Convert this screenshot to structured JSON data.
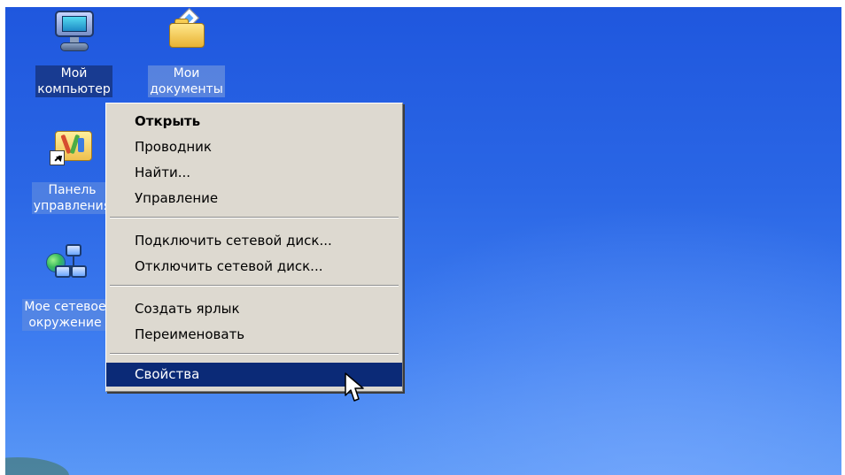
{
  "desktop": {
    "icons": [
      {
        "name": "my-computer",
        "icon": "computer-icon",
        "label_lines": [
          "Мой",
          "компьютер"
        ]
      },
      {
        "name": "my-documents",
        "icon": "documents-folder-icon",
        "label_lines": [
          "Мои",
          "документы"
        ]
      },
      {
        "name": "control-panel",
        "icon": "control-panel-icon",
        "label_lines": [
          "Панель",
          "управления"
        ]
      },
      {
        "name": "network-places",
        "icon": "network-places-icon",
        "label_lines": [
          "Мое сетевое",
          "окружение"
        ]
      }
    ]
  },
  "context_menu": {
    "items": [
      {
        "label": "Открыть",
        "default": true
      },
      {
        "label": "Проводник"
      },
      {
        "label": "Найти..."
      },
      {
        "label": "Управление"
      },
      {
        "label": "Подключить сетевой диск..."
      },
      {
        "label": "Отключить сетевой диск..."
      },
      {
        "label": "Создать ярлык"
      },
      {
        "label": "Переименовать"
      },
      {
        "label": "Свойства",
        "selected": true
      }
    ]
  },
  "cursor": {
    "icon": "mouse-pointer-icon"
  },
  "colors": {
    "desktop_blue": "#2a66e5",
    "menu_background": "#ddd9d0",
    "selection_blue": "#0b2a77",
    "text_white": "#ffffff"
  }
}
